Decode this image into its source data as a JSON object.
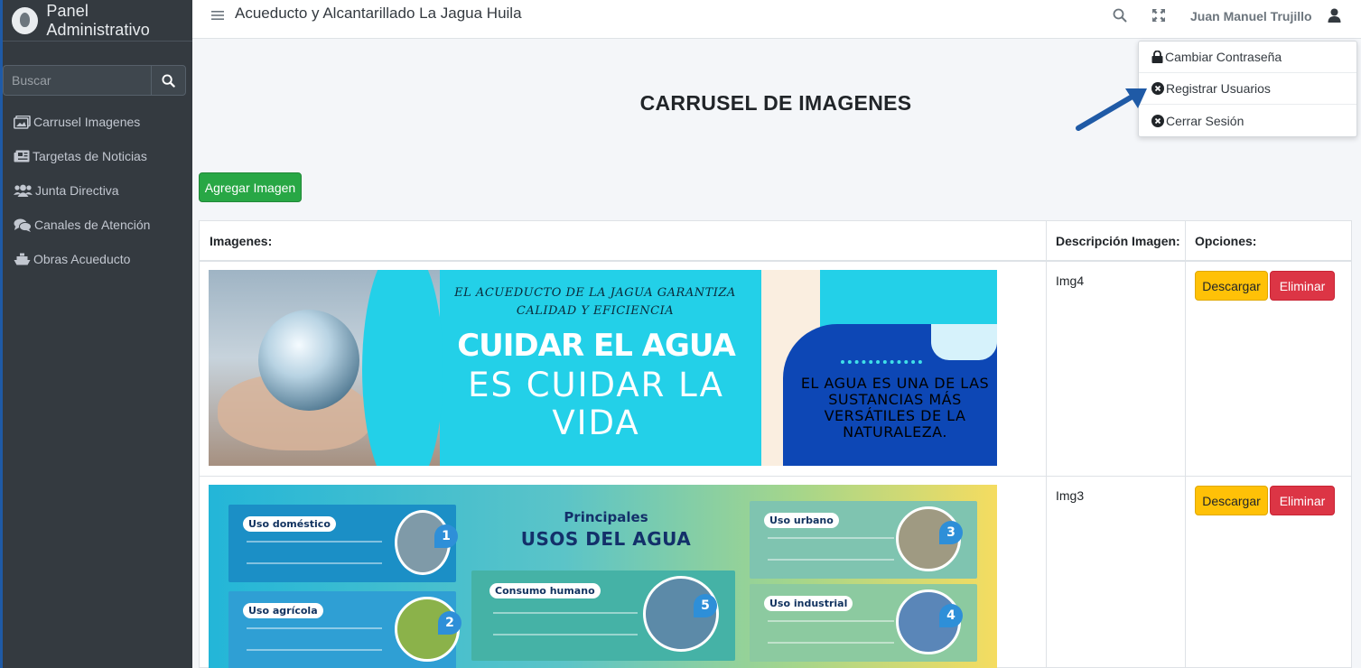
{
  "sidebar": {
    "brand": "Panel Administrativo",
    "search_placeholder": "Buscar",
    "items": [
      {
        "label": "Carrusel Imagenes",
        "icon": "images-icon"
      },
      {
        "label": "Targetas de Noticias",
        "icon": "newspaper-icon"
      },
      {
        "label": "Junta Directiva",
        "icon": "users-icon"
      },
      {
        "label": "Canales de Atención",
        "icon": "comments-icon"
      },
      {
        "label": "Obras Acueducto",
        "icon": "ship-icon"
      }
    ]
  },
  "header": {
    "title": "Acueducto y Alcantarillado La Jagua Huila",
    "username": "Juan Manuel Trujillo"
  },
  "dropdown": {
    "items": [
      {
        "label": "Cambiar Contraseña",
        "icon": "lock-icon"
      },
      {
        "label": "Registrar Usuarios",
        "icon": "circle-x-icon"
      },
      {
        "label": "Cerrar Sesión",
        "icon": "circle-x-icon"
      }
    ]
  },
  "page": {
    "title": "CARRUSEL DE IMAGENES",
    "add_button": "Agregar Imagen"
  },
  "table": {
    "headers": [
      "Imagenes:",
      "Descripción Imagen:",
      "Opciones:"
    ],
    "rows": [
      {
        "description": "Img4",
        "download": "Descargar",
        "delete": "Eliminar"
      },
      {
        "description": "Img3",
        "download": "Descargar",
        "delete": "Eliminar"
      }
    ]
  },
  "banner1": {
    "small": "EL ACUEDUCTO DE LA JAGUA GARANTIZA CALIDAD Y EFICIENCIA",
    "big": "CUIDAR EL AGUA",
    "mid": "ES CUIDAR LA VIDA",
    "side": "EL AGUA ES UNA DE LAS SUSTANCIAS MÁS VERSÁTILES DE LA NATURALEZA."
  },
  "banner2": {
    "title1": "Principales",
    "title2": "USOS DEL AGUA",
    "cards": [
      "Uso doméstico",
      "Uso agrícola",
      "Consumo humano",
      "Uso urbano",
      "Uso industrial"
    ],
    "numbers": [
      "1",
      "2",
      "5",
      "3",
      "4"
    ]
  },
  "colors": {
    "sidebar_bg": "#343a40",
    "success": "#28a745",
    "warning": "#ffc107",
    "danger": "#dc3545",
    "arrow": "#1f5aa6"
  }
}
